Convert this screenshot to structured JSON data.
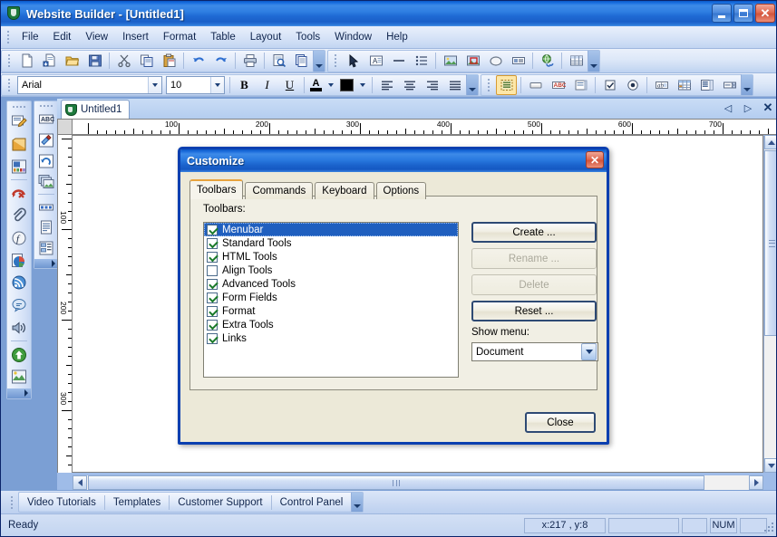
{
  "window": {
    "title_app": "Website Builder",
    "title_doc": " - [Untitled1]",
    "icon": "shield-icon",
    "minimize_label": "_",
    "maximize_label": "",
    "close_label": "✕"
  },
  "menubar": {
    "items": [
      {
        "label": "File",
        "accel": "F"
      },
      {
        "label": "Edit",
        "accel": "E"
      },
      {
        "label": "View",
        "accel": "V"
      },
      {
        "label": "Insert",
        "accel": "I"
      },
      {
        "label": "Format",
        "accel": "o"
      },
      {
        "label": "Table",
        "accel": "b"
      },
      {
        "label": "Layout",
        "accel": "L"
      },
      {
        "label": "Tools",
        "accel": "T"
      },
      {
        "label": "Window",
        "accel": "W"
      },
      {
        "label": "Help",
        "accel": "H"
      }
    ]
  },
  "toolbar_row1": {
    "standard_buttons": [
      "new-document-icon",
      "new-from-template-icon",
      "open-folder-icon",
      "save-icon",
      "cut-scissors-icon",
      "copy-icon",
      "paste-icon",
      "undo-icon",
      "redo-icon",
      "print-icon",
      "print-preview-icon",
      "page-properties-icon"
    ],
    "html_buttons": [
      "pointer-select-icon",
      "text-object-icon",
      "line-icon",
      "list-icon",
      "image-icon",
      "image-map-icon",
      "shape-icon",
      "banner-icon",
      "hyperlink-globe-icon",
      "table-icon"
    ],
    "overflow_label": "toolbar-overflow-chevron"
  },
  "toolbar_row2": {
    "font_name": "Arial",
    "font_size": "10",
    "bold_label": "B",
    "italic_label": "I",
    "underline_label": "U",
    "font_color_label": "A",
    "font_color_swatch": "#000000",
    "highlight_swatch": "#000000",
    "align_buttons": [
      "align-left-icon",
      "align-center-icon",
      "align-right-icon",
      "align-justify-icon"
    ],
    "form_buttons": [
      "form-container-icon",
      "form-button-icon",
      "text-field-abc-icon",
      "textarea-icon",
      "checkbox-icon",
      "radio-button-icon",
      "label-icon",
      "table-grid-icon",
      "listbox-icon",
      "dropdown-icon"
    ]
  },
  "left_toolbar_outer": {
    "buttons": [
      "edit-page-icon",
      "layer-icon",
      "slideshow-icon",
      "remove-format-icon",
      "attachment-icon",
      "flash-icon",
      "pie-chart-icon",
      "rss-icon",
      "comment-icon",
      "sound-icon",
      "upload-publish-icon",
      "extensions-icon"
    ],
    "overflow_label": "left-toolbar-overflow-chevron"
  },
  "left_toolbar_inner": {
    "buttons": [
      "spellcheck-abc-icon",
      "paint-icon",
      "rotate-icon",
      "layers-stack-icon",
      "navbar-icon",
      "document-icon",
      "form-list-icon"
    ],
    "overflow_label": "inner-toolbar-overflow-chevron"
  },
  "document": {
    "tab_label": "Untitled1",
    "tab_icon": "shield-icon",
    "mdi_prev": "◁",
    "mdi_next": "▷",
    "mdi_close": "✕",
    "h_ruler_labels": [
      "100",
      "200",
      "300",
      "400",
      "500",
      "600",
      "700"
    ],
    "v_ruler_labels": [
      "100",
      "200",
      "300"
    ],
    "scroll_up": "▲",
    "scroll_down": "▼",
    "scroll_left": "❮",
    "scroll_right": "❯"
  },
  "dialog": {
    "title": "Customize",
    "close_label": "✕",
    "tabs": [
      {
        "label": "Toolbars",
        "selected": true
      },
      {
        "label": "Commands",
        "selected": false
      },
      {
        "label": "Keyboard",
        "selected": false
      },
      {
        "label": "Options",
        "selected": false
      }
    ],
    "toolbars_label": "Toolbars:",
    "toolbar_items": [
      {
        "label": "Menubar",
        "checked": true,
        "selected": true
      },
      {
        "label": "Standard Tools",
        "checked": true,
        "selected": false
      },
      {
        "label": "HTML Tools",
        "checked": true,
        "selected": false
      },
      {
        "label": "Align Tools",
        "checked": false,
        "selected": false
      },
      {
        "label": "Advanced Tools",
        "checked": true,
        "selected": false
      },
      {
        "label": "Form Fields",
        "checked": true,
        "selected": false
      },
      {
        "label": "Format",
        "checked": true,
        "selected": false
      },
      {
        "label": "Extra Tools",
        "checked": true,
        "selected": false
      },
      {
        "label": "Links",
        "checked": true,
        "selected": false
      }
    ],
    "buttons": {
      "create": "Create ...",
      "rename": "Rename ...",
      "delete": "Delete",
      "reset": "Reset ...",
      "close": "Close"
    },
    "show_menu_label": "Show menu:",
    "show_menu_value": "Document",
    "show_menu_options": [
      "Document"
    ]
  },
  "linkbar": {
    "items": [
      "Video Tutorials",
      "Templates",
      "Customer Support",
      "Control Panel"
    ],
    "overflow_label": "linkbar-overflow-chevron"
  },
  "statusbar": {
    "message": "Ready",
    "coords": "x:217 , y:8",
    "pane_blank1": "",
    "pane_blank2": "",
    "num_indicator": "NUM",
    "pane_blank3": ""
  },
  "colors": {
    "titlebar_blue": "#1f6fdc",
    "dialog_face": "#ece9d8",
    "selection_blue": "#1f5fbf",
    "tab_accent_orange": "#e8a33d",
    "app_background": "#7b9fd4"
  }
}
